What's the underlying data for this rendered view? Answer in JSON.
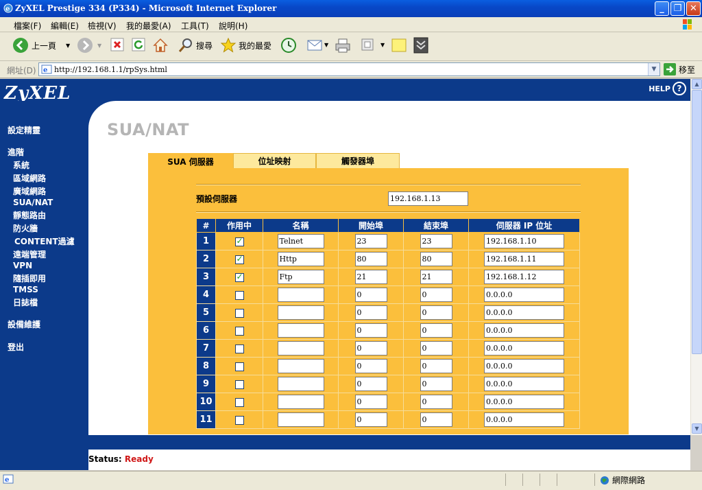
{
  "window": {
    "title": "ZyXEL Prestige 334 (P334) - Microsoft Internet Explorer"
  },
  "menu": [
    "檔案(F)",
    "編輯(E)",
    "檢視(V)",
    "我的最愛(A)",
    "工具(T)",
    "說明(H)"
  ],
  "toolbar": {
    "back_label": "上一頁",
    "search_label": "搜尋",
    "favorites_label": "我的最愛"
  },
  "address": {
    "label": "網址(D)",
    "url": "http://192.168.1.1/rpSys.html",
    "go_label": "移至"
  },
  "header": {
    "logo": "ZyXEL",
    "help_label": "HELP",
    "help_glyph": "?"
  },
  "nav": {
    "wizard": "設定精靈",
    "advanced": "進階",
    "items": [
      "系統",
      "區域網路",
      "廣域網路",
      "SUA/NAT",
      "靜態路由",
      "防火牆",
      "CONTENT過濾",
      "遠端管理",
      "VPN",
      "隨插即用",
      "TMSS",
      "日誌檔"
    ],
    "maintenance": "設備維護",
    "logout": "登出"
  },
  "page": {
    "title": "SUA/NAT"
  },
  "tabs": [
    "SUA 伺服器",
    "位址映射",
    "觸發器埠"
  ],
  "default_server": {
    "label": "預設伺服器",
    "value": "192.168.1.13"
  },
  "table": {
    "headers": [
      "#",
      "作用中",
      "名稱",
      "開始埠",
      "結束埠",
      "伺服器 IP 位址"
    ],
    "rows": [
      {
        "num": "1",
        "active": true,
        "name": "Telnet",
        "start": "23",
        "end": "23",
        "ip": "192.168.1.10"
      },
      {
        "num": "2",
        "active": true,
        "name": "Http",
        "start": "80",
        "end": "80",
        "ip": "192.168.1.11"
      },
      {
        "num": "3",
        "active": true,
        "name": "Ftp",
        "start": "21",
        "end": "21",
        "ip": "192.168.1.12"
      },
      {
        "num": "4",
        "active": false,
        "name": "",
        "start": "0",
        "end": "0",
        "ip": "0.0.0.0"
      },
      {
        "num": "5",
        "active": false,
        "name": "",
        "start": "0",
        "end": "0",
        "ip": "0.0.0.0"
      },
      {
        "num": "6",
        "active": false,
        "name": "",
        "start": "0",
        "end": "0",
        "ip": "0.0.0.0"
      },
      {
        "num": "7",
        "active": false,
        "name": "",
        "start": "0",
        "end": "0",
        "ip": "0.0.0.0"
      },
      {
        "num": "8",
        "active": false,
        "name": "",
        "start": "0",
        "end": "0",
        "ip": "0.0.0.0"
      },
      {
        "num": "9",
        "active": false,
        "name": "",
        "start": "0",
        "end": "0",
        "ip": "0.0.0.0"
      },
      {
        "num": "10",
        "active": false,
        "name": "",
        "start": "0",
        "end": "0",
        "ip": "0.0.0.0"
      },
      {
        "num": "11",
        "active": false,
        "name": "",
        "start": "0",
        "end": "0",
        "ip": "0.0.0.0"
      }
    ]
  },
  "status": {
    "label": "Status:",
    "value": "Ready"
  },
  "statusbar": {
    "zone": "網際網路"
  },
  "colors": {
    "brand_blue": "#0c3a8a",
    "panel_orange": "#fbbf3c",
    "status_red": "#d01818"
  }
}
